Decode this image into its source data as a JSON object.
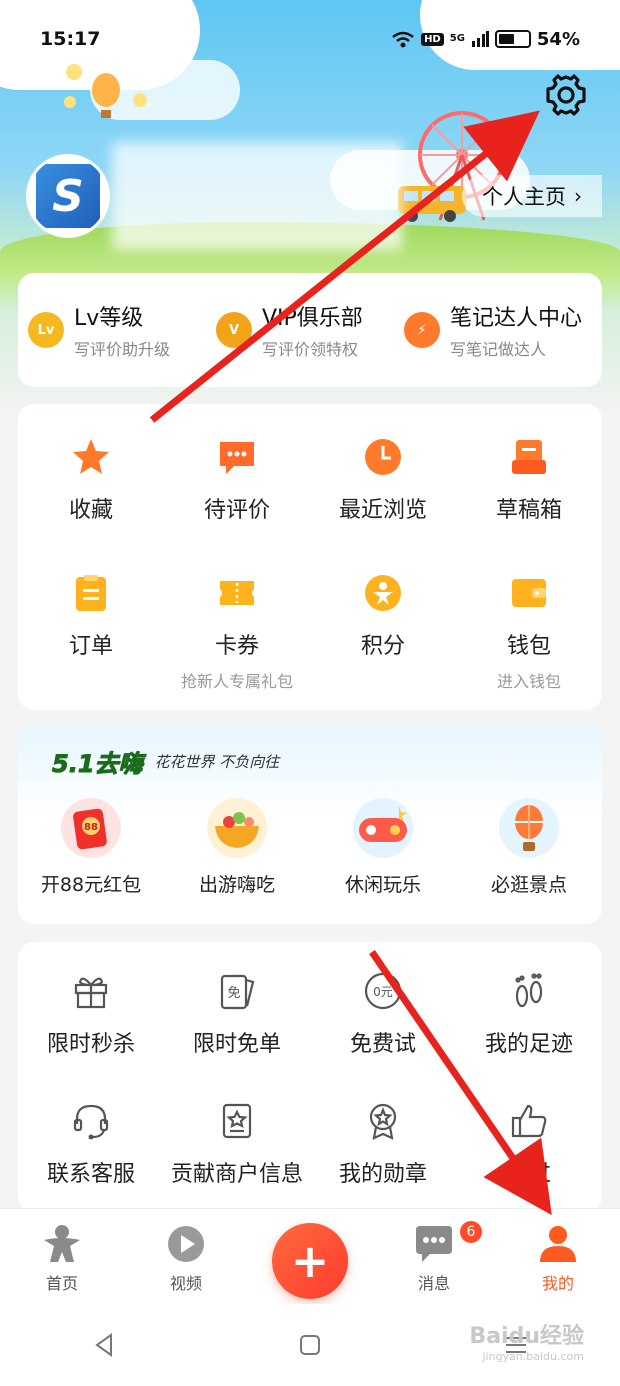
{
  "status_bar": {
    "time": "15:17",
    "hd": "HD",
    "network": "5G",
    "battery": "54%",
    "battery_level": 0.54
  },
  "header": {
    "homepage_label": "个人主页"
  },
  "levels": [
    {
      "icon": "Lv",
      "title": "Lv等级",
      "subtitle": "写评价助升级",
      "color": "#f6b81e"
    },
    {
      "icon": "V",
      "title": "VIP俱乐部",
      "subtitle": "写评价领特权",
      "color": "#f3a316"
    },
    {
      "icon": "⚡",
      "title": "笔记达人中心",
      "subtitle": "写笔记做达人",
      "color": "#ff7a2a"
    }
  ],
  "features": [
    {
      "label": "收藏",
      "sub": "",
      "icon": "star-icon"
    },
    {
      "label": "待评价",
      "sub": "",
      "icon": "comment-icon"
    },
    {
      "label": "最近浏览",
      "sub": "",
      "icon": "clock-icon"
    },
    {
      "label": "草稿箱",
      "sub": "",
      "icon": "draft-icon"
    },
    {
      "label": "订单",
      "sub": "",
      "icon": "order-icon"
    },
    {
      "label": "卡券",
      "sub": "抢新人专属礼包",
      "icon": "coupon-icon"
    },
    {
      "label": "积分",
      "sub": "",
      "icon": "points-icon"
    },
    {
      "label": "钱包",
      "sub": "进入钱包",
      "icon": "wallet-icon"
    }
  ],
  "promo": {
    "title": "5.1去嗨",
    "subtitle": "花花世界 不负向往",
    "items": [
      {
        "label": "开88元红包",
        "icon": "red-packet-icon",
        "inner": "88"
      },
      {
        "label": "出游嗨吃",
        "icon": "food-bowl-icon",
        "inner": ""
      },
      {
        "label": "休闲玩乐",
        "icon": "gamepad-icon",
        "inner": ""
      },
      {
        "label": "必逛景点",
        "icon": "balloon-icon",
        "inner": ""
      }
    ]
  },
  "services": [
    {
      "label": "限时秒杀",
      "icon": "gift-icon",
      "inner": ""
    },
    {
      "label": "限时免单",
      "icon": "free-ticket-icon",
      "inner": "免"
    },
    {
      "label": "免费试",
      "icon": "zero-yuan-icon",
      "inner": "0元"
    },
    {
      "label": "我的足迹",
      "icon": "footprint-icon",
      "inner": ""
    },
    {
      "label": "联系客服",
      "icon": "headset-icon",
      "inner": ""
    },
    {
      "label": "贡献商户信息",
      "icon": "shop-info-icon",
      "inner": ""
    },
    {
      "label": "我的勋章",
      "icon": "medal-icon",
      "inner": ""
    },
    {
      "label": "赞过",
      "icon": "thumbs-up-icon",
      "inner": ""
    }
  ],
  "tabbar": {
    "home": "首页",
    "video": "视频",
    "post": "+",
    "messages": "消息",
    "messages_badge": "6",
    "mine": "我的"
  },
  "watermark": {
    "main": "Baidu经验",
    "sub": "jingyan.baidu.com"
  },
  "colors": {
    "accent": "#ff5a1f",
    "arrow": "#e8231d"
  }
}
